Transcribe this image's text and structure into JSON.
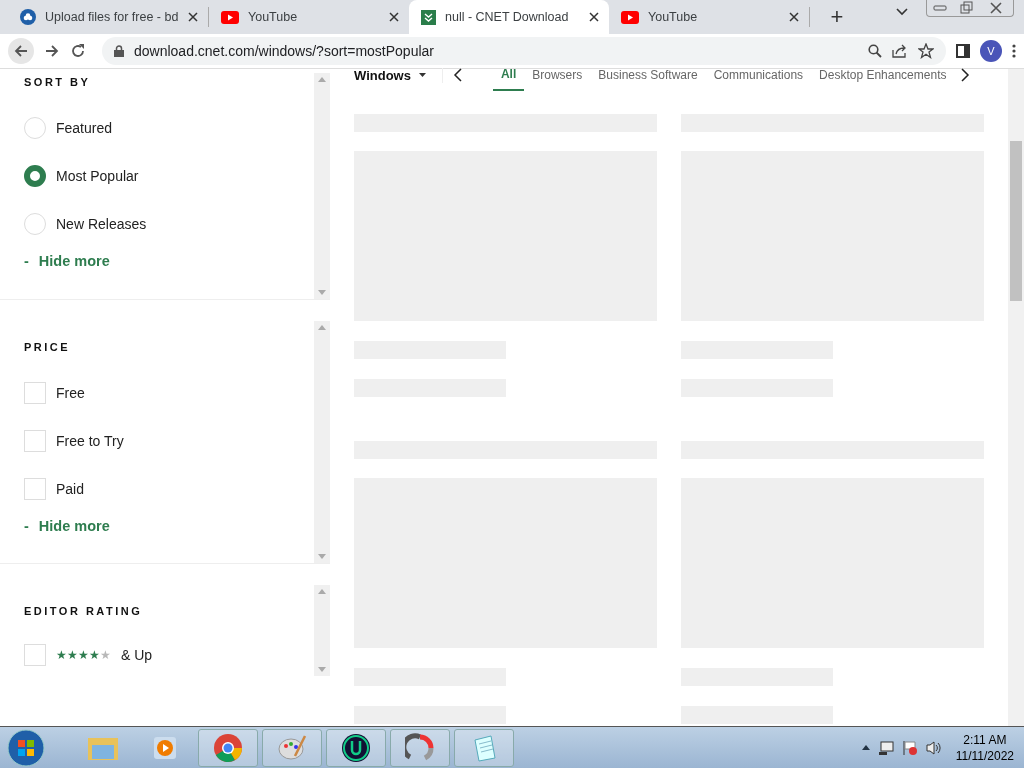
{
  "browser": {
    "tabs": [
      {
        "title": "Upload files for free - bd",
        "kind": "cloud",
        "selected": false
      },
      {
        "title": "YouTube",
        "kind": "video",
        "selected": false
      },
      {
        "title": "null - CNET Download",
        "kind": "download",
        "selected": true
      },
      {
        "title": "YouTube",
        "kind": "video",
        "selected": false
      }
    ],
    "new_tab": "+",
    "url": "download.cnet.com/windows/?sort=mostPopular",
    "profile": "V"
  },
  "categories": {
    "platform": "Windows",
    "items": [
      {
        "label": "All",
        "selected": true
      },
      {
        "label": "Browsers",
        "selected": false
      },
      {
        "label": "Business Software",
        "selected": false
      },
      {
        "label": "Communications",
        "selected": false
      },
      {
        "label": "Desktop Enhancements",
        "selected": false
      }
    ]
  },
  "filters": [
    {
      "title": "SORT BY",
      "kind": "radio",
      "options": [
        {
          "label": "Featured",
          "selected": false
        },
        {
          "label": "Most Popular",
          "selected": true
        },
        {
          "label": "New Releases",
          "selected": false
        }
      ],
      "toggle": "Hide more",
      "toggle_sign": "-"
    },
    {
      "title": "PRICE",
      "kind": "checkbox",
      "options": [
        {
          "label": "Free",
          "checked": false
        },
        {
          "label": "Free to Try",
          "checked": false
        },
        {
          "label": "Paid",
          "checked": false
        }
      ],
      "toggle": "Hide more",
      "toggle_sign": "-"
    },
    {
      "title": "EDITOR RATING",
      "kind": "rating",
      "options": [
        {
          "label": "& Up",
          "checked": false,
          "stars": 4
        }
      ]
    }
  ],
  "taskbar": {
    "time": "2:11 AM",
    "date": "11/11/2022"
  }
}
